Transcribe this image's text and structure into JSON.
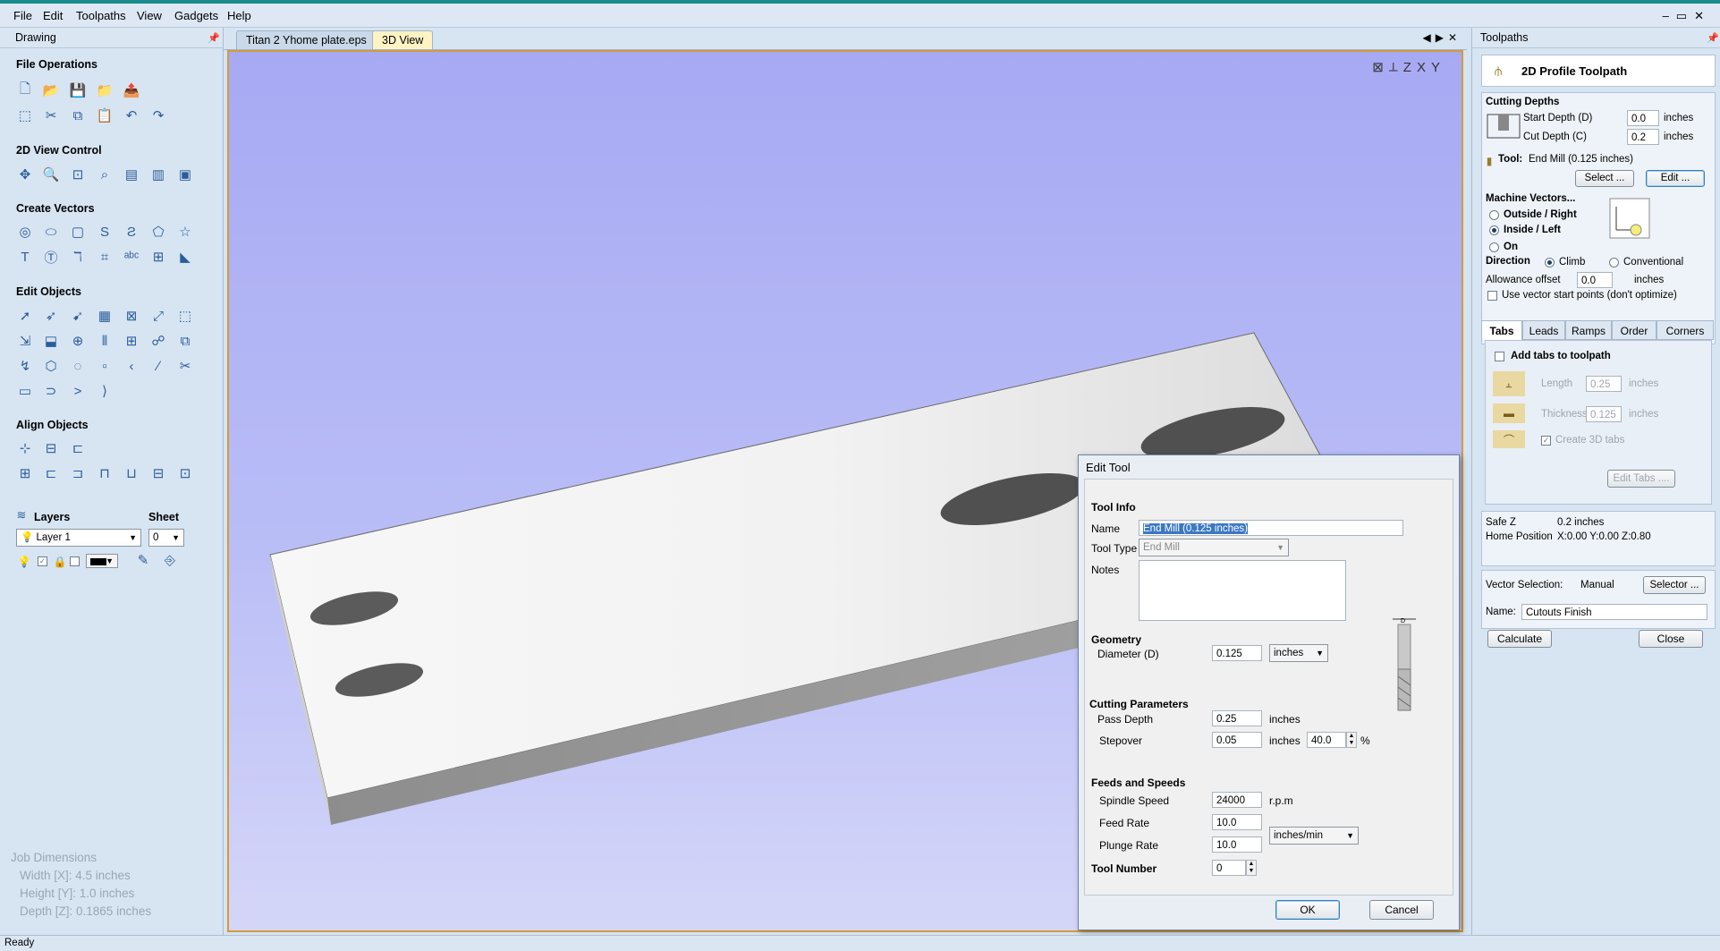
{
  "menu": [
    "File",
    "Edit",
    "Toolpaths",
    "View",
    "Gadgets",
    "Help"
  ],
  "window_controls": [
    "–",
    "▭",
    "✕"
  ],
  "left_panel": {
    "title": "Drawing",
    "sections": {
      "file_operations": "File Operations",
      "view_control": "2D View Control",
      "create_vectors": "Create Vectors",
      "edit_objects": "Edit Objects",
      "align_objects": "Align Objects"
    },
    "layers_label": "Layers",
    "sheet_label": "Sheet",
    "layer_value": "Layer 1",
    "sheet_value": "0",
    "job_dimensions": {
      "title": "Job Dimensions",
      "width": "Width  [X]: 4.5 inches",
      "height": "Height [Y]: 1.0 inches",
      "depth": "Depth  [Z]: 0.1865 inches"
    }
  },
  "tabs": [
    {
      "label": "Titan 2 Yhome plate.eps",
      "active": false
    },
    {
      "label": "3D View",
      "active": true
    }
  ],
  "dialog": {
    "title": "Edit Tool",
    "tool_info": "Tool Info",
    "name_label": "Name",
    "name_value": "End Mill (0.125 inches)",
    "tool_type_label": "Tool Type",
    "tool_type_value": "End Mill",
    "notes_label": "Notes",
    "geometry": "Geometry",
    "diameter_label": "Diameter (D)",
    "diameter_value": "0.125",
    "units_value": "inches",
    "cutting_parameters": "Cutting Parameters",
    "pass_depth_label": "Pass Depth",
    "pass_depth_value": "0.25",
    "pass_depth_unit": "inches",
    "stepover_label": "Stepover",
    "stepover_value": "0.05",
    "stepover_unit": "inches",
    "stepover_pct": "40.0",
    "pct_sign": "%",
    "feeds_speeds": "Feeds and Speeds",
    "spindle_label": "Spindle Speed",
    "spindle_value": "24000",
    "spindle_unit": "r.p.m",
    "feed_label": "Feed Rate",
    "feed_value": "10.0",
    "plunge_label": "Plunge Rate",
    "plunge_value": "10.0",
    "rate_unit": "inches/min",
    "tool_number_label": "Tool Number",
    "tool_number_value": "0",
    "ok": "OK",
    "cancel": "Cancel"
  },
  "right_panel": {
    "title": "Toolpaths",
    "heading": "2D Profile Toolpath",
    "cutting_depths": "Cutting Depths",
    "start_depth_label": "Start Depth (D)",
    "start_depth_value": "0.0",
    "cut_depth_label": "Cut Depth (C)",
    "cut_depth_value": "0.2",
    "inches": "inches",
    "tool_label": "Tool:",
    "tool_value": "End Mill (0.125 inches)",
    "select_btn": "Select ...",
    "edit_btn": "Edit ...",
    "machine_vectors": "Machine Vectors...",
    "outside_right": "Outside / Right",
    "inside_left": "Inside / Left",
    "on": "On",
    "direction": "Direction",
    "climb": "Climb",
    "conventional": "Conventional",
    "allowance_label": "Allowance offset",
    "allowance_value": "0.0",
    "use_start_points": "Use vector start points (don't optimize)",
    "subtabs": [
      "Tabs",
      "Leads",
      "Ramps",
      "Order",
      "Corners"
    ],
    "add_tabs": "Add tabs to toolpath",
    "length_label": "Length",
    "length_value": "0.25",
    "thickness_label": "Thickness",
    "thickness_value": "0.125",
    "create_3d_tabs": "Create 3D tabs",
    "edit_tabs_btn": "Edit Tabs ....",
    "safe_z_label": "Safe Z",
    "safe_z_value": "0.2 inches",
    "home_label": "Home Position",
    "home_value": "X:0.00 Y:0.00 Z:0.80",
    "vector_selection_label": "Vector Selection:",
    "vector_selection_value": "Manual",
    "selector_btn": "Selector ...",
    "name_label": "Name:",
    "name_value": "Cutouts Finish",
    "calculate_btn": "Calculate",
    "close_btn": "Close"
  },
  "status": "Ready"
}
